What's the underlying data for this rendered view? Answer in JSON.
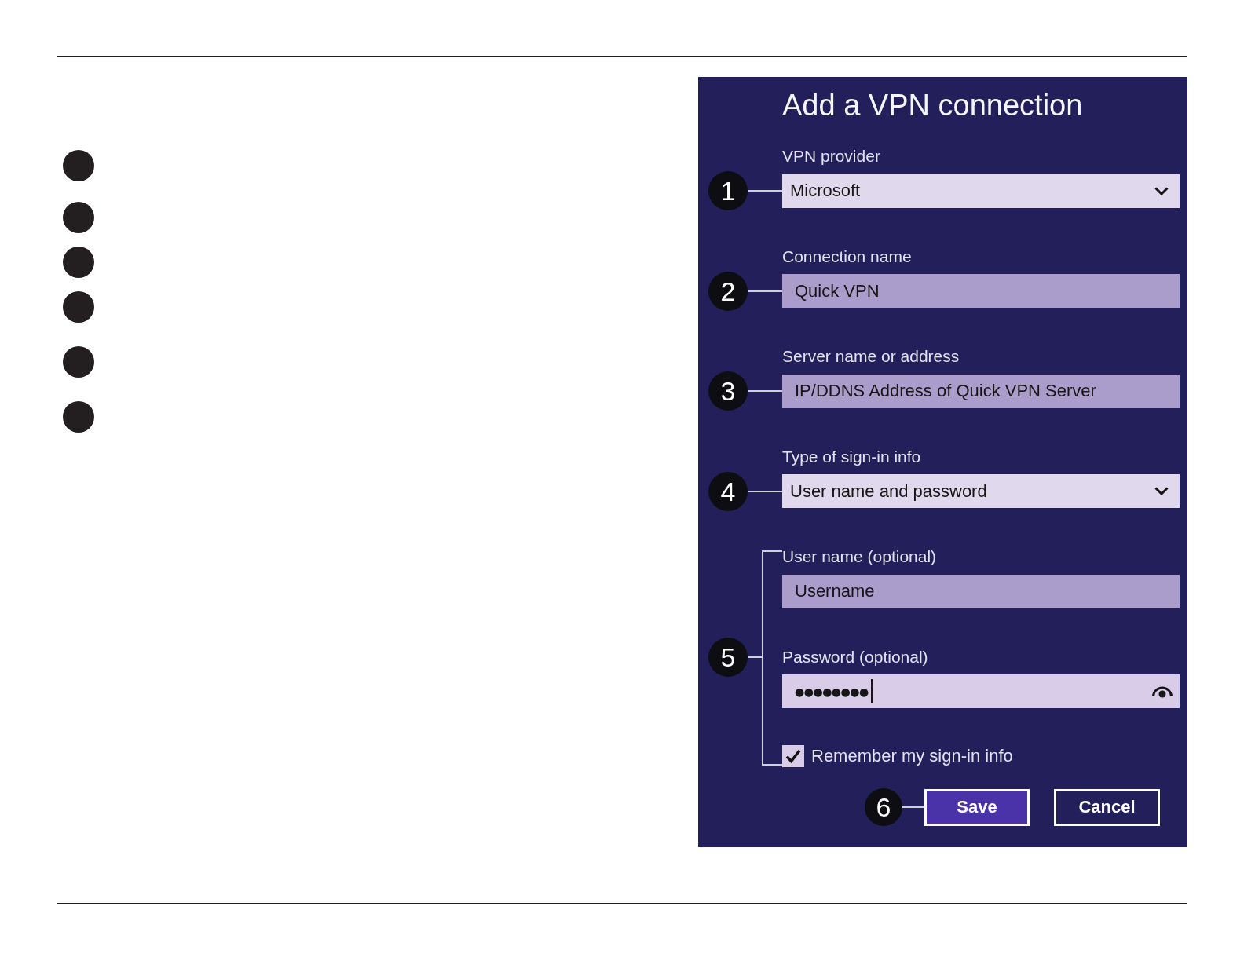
{
  "left_column": {
    "markers": [
      {
        "kind": "dot"
      },
      {
        "kind": "dot"
      },
      {
        "kind": "dot"
      },
      {
        "kind": "dot"
      },
      {
        "kind": "dot"
      },
      {
        "kind": "dot"
      }
    ]
  },
  "dialog": {
    "title": "Add a VPN connection",
    "fields": [
      {
        "kind": "dropdown",
        "label": "VPN provider",
        "value": "Microsoft",
        "callout": "1",
        "focused": false
      },
      {
        "kind": "text",
        "label": "Connection name",
        "value": "Quick VPN",
        "callout": "2",
        "focused": false
      },
      {
        "kind": "text",
        "label": "Server name or address",
        "value": "IP/DDNS Address of Quick VPN Server",
        "callout": "3",
        "focused": false
      },
      {
        "kind": "dropdown",
        "label": "Type of sign-in info",
        "value": "User name and password",
        "callout": "4",
        "focused": false
      }
    ],
    "sign_in": {
      "callout": "5",
      "fields": [
        {
          "kind": "text",
          "label": "User name (optional)",
          "value": "Username",
          "focused": false
        },
        {
          "kind": "password",
          "label": "Password (optional)",
          "value": "●●●●●●●●",
          "focused": true
        }
      ],
      "remember": {
        "label": "Remember my sign-in info",
        "checked": true
      }
    },
    "actions": {
      "callout": "6",
      "buttons": [
        {
          "kind": "primary",
          "label": "Save"
        },
        {
          "kind": "secondary",
          "label": "Cancel"
        }
      ]
    }
  }
}
